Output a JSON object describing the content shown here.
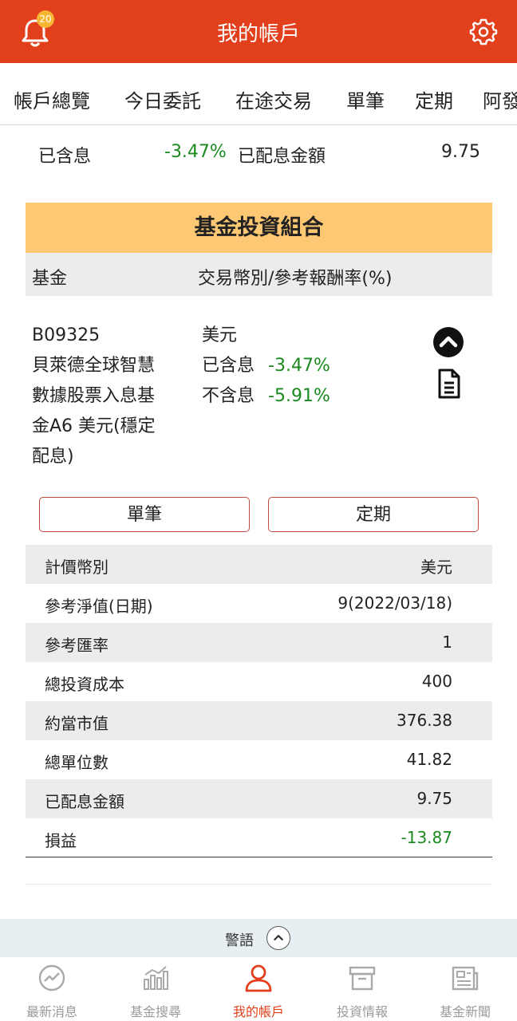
{
  "header": {
    "title": "我的帳戶",
    "badge_count": "20",
    "brand_color": "#e2401c"
  },
  "tabs": [
    "帳戶總覽",
    "今日委託",
    "在途交易",
    "單筆",
    "定期",
    "阿發"
  ],
  "summary_row": {
    "label": "已含息",
    "value": "-3.47%",
    "dividend_label": "已配息金額",
    "dividend_value": "9.75"
  },
  "portfolio": {
    "title": "基金投資組合",
    "col_fund": "基金",
    "col_currency": "交易幣別/參考報酬率(%)",
    "fund_code": "B09325",
    "fund_name_lines": [
      "貝萊德全球智慧",
      "數據股票入息基",
      "金A6 美元(穩定",
      "配息)"
    ],
    "currency": "美元",
    "incl_label": "已含息",
    "incl_value": "-3.47%",
    "excl_label": "不含息",
    "excl_value": "-5.91%"
  },
  "buttons": {
    "single": "單筆",
    "regular": "定期"
  },
  "details": [
    {
      "label": "計價幣別",
      "value": "美元"
    },
    {
      "label": "參考淨值(日期)",
      "value": "9(2022/03/18)"
    },
    {
      "label": "參考匯率",
      "value": "1"
    },
    {
      "label": "總投資成本",
      "value": "400"
    },
    {
      "label": "約當市值",
      "value": "376.38"
    },
    {
      "label": "總單位數",
      "value": "41.82"
    },
    {
      "label": "已配息金額",
      "value": "9.75"
    },
    {
      "label": "損益",
      "value": "-13.87"
    }
  ],
  "warning": {
    "label": "警語"
  },
  "nav": [
    {
      "label": "最新消息",
      "icon": "news-trend-icon"
    },
    {
      "label": "基金搜尋",
      "icon": "bar-chart-icon"
    },
    {
      "label": "我的帳戶",
      "icon": "user-icon"
    },
    {
      "label": "投資情報",
      "icon": "archive-box-icon"
    },
    {
      "label": "基金新聞",
      "icon": "newspaper-icon"
    }
  ]
}
